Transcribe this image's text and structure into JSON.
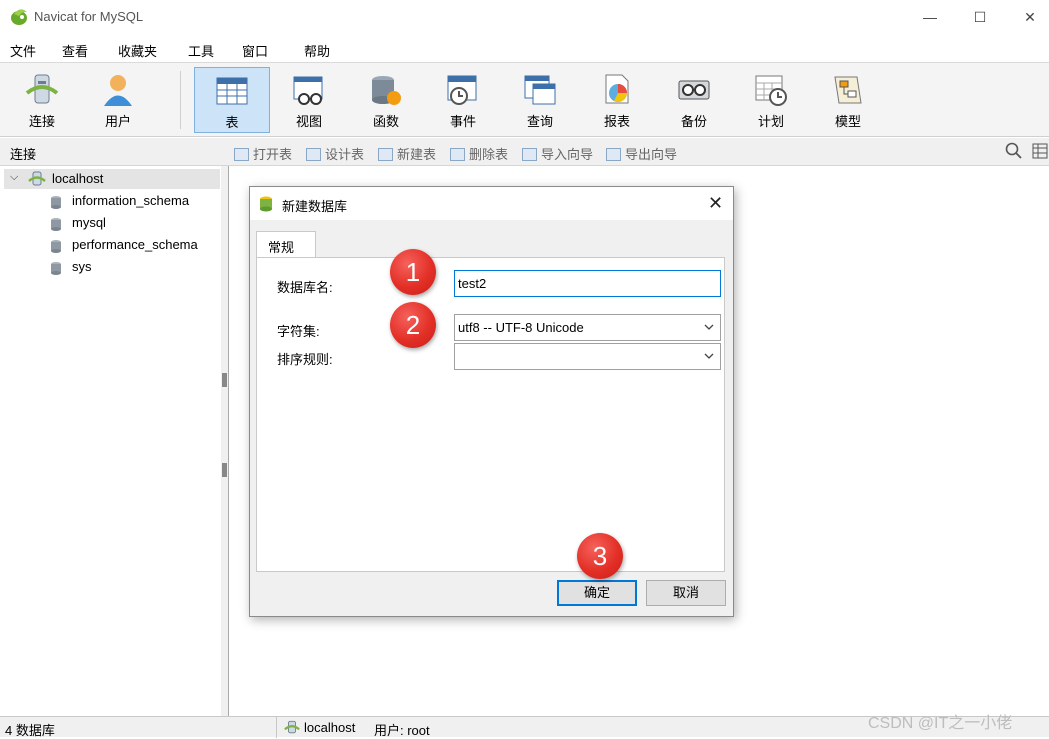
{
  "window": {
    "title": "Navicat for MySQL",
    "minimize": "—",
    "maximize": "☐",
    "close": "✕"
  },
  "menu": [
    "文件",
    "查看",
    "收藏夹",
    "工具",
    "窗口",
    "帮助"
  ],
  "toolbar": {
    "connect": "连接",
    "user": "用户",
    "table": "表",
    "view": "视图",
    "function": "函数",
    "event": "事件",
    "query": "查询",
    "report": "报表",
    "backup": "备份",
    "schedule": "计划",
    "model": "模型"
  },
  "subbar": {
    "connection_label": "连接",
    "open_table": "打开表",
    "design_table": "设计表",
    "new_table": "新建表",
    "delete_table": "删除表",
    "import_wizard": "导入向导",
    "export_wizard": "导出向导"
  },
  "tree": {
    "root": "localhost",
    "databases": [
      "information_schema",
      "mysql",
      "performance_schema",
      "sys"
    ]
  },
  "status": {
    "db_count": "4 数据库",
    "connection": "localhost",
    "user": "用户: root"
  },
  "watermark": "CSDN @IT之一小佬",
  "dialog": {
    "title": "新建数据库",
    "tab": "常规",
    "db_name_label": "数据库名:",
    "db_name_value": "test2",
    "charset_label": "字符集:",
    "charset_value": "utf8 -- UTF-8 Unicode",
    "collation_label": "排序规则:",
    "collation_value": "",
    "ok": "确定",
    "cancel": "取消"
  },
  "annotations": [
    "1",
    "2",
    "3"
  ],
  "colors": {
    "toolbar_active": "#cde3f7",
    "input_focus": "#0078d7",
    "badge": "#e33027"
  }
}
